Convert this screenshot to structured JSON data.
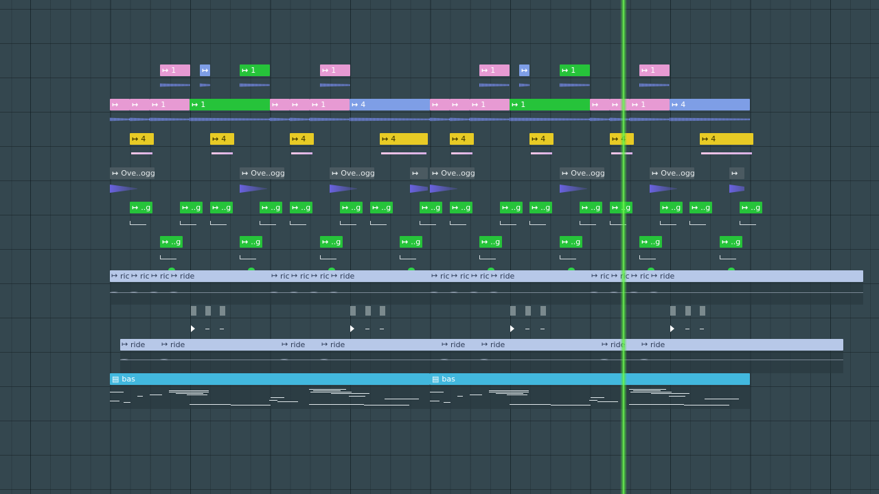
{
  "playlist": {
    "ride_label": "ride",
    "ride_short": "ric",
    "bas_label": "bas",
    "ove_label": "Ove..ogg",
    "g_label": "..g",
    "one_label": "1",
    "four_label": "4",
    "accent_colors": {
      "pink": "#e79ad3",
      "blue": "#7e9ee6",
      "green": "#26c33a",
      "yellow": "#e8cb25",
      "ride": "#b7c8e8",
      "bas": "#42b8de",
      "playhead": "#7dff5a"
    },
    "icons": {
      "clip_tag": "audio-clip-icon",
      "pattern_tag": "pattern-clip-icon"
    }
  }
}
